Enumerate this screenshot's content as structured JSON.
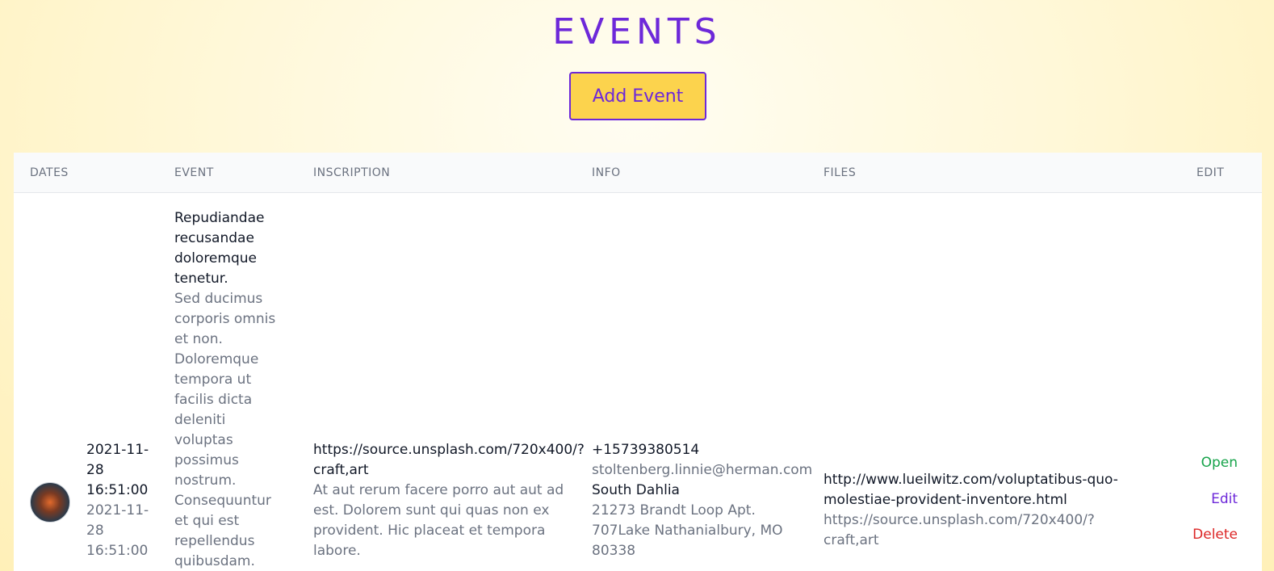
{
  "page": {
    "title": "EVENTS",
    "add_button": "Add Event"
  },
  "table": {
    "headers": {
      "dates": "DATES",
      "event": "EVENT",
      "inscription": "INSCRIPTION",
      "info": "INFO",
      "files": "FILES",
      "edit": "EDIT"
    },
    "rows": [
      {
        "avatar_icon": "event-thumbnail",
        "date_start": "2021-11-28 16:51:00",
        "date_end": "2021-11-28 16:51:00",
        "event_title": "Repudiandae recusandae doloremque tenetur.",
        "event_description": "Sed ducimus corporis omnis et non. Doloremque tempora ut facilis dicta deleniti voluptas possimus nostrum. Consequuntur et qui est repellendus quibusdam. Consectetur",
        "inscription_url": "https://source.unsplash.com/720x400/?craft,art",
        "inscription_text": "At aut rerum facere porro aut aut ad est. Dolorem sunt qui quas non ex provident. Hic placeat et tempora labore.",
        "phone": "+15739380514",
        "email": "stoltenberg.linnie@herman.com",
        "city": "South Dahlia",
        "address": "21273 Brandt Loop Apt. 707Lake Nathanialbury, MO 80338",
        "file_url": "http://www.lueilwitz.com/voluptatibus-quo-molestiae-provident-inventore.html",
        "file_image": "https://source.unsplash.com/720x400/?craft,art",
        "actions": {
          "open": "Open",
          "edit": "Edit",
          "delete": "Delete"
        }
      }
    ]
  },
  "colors": {
    "accent": "#6d28d9",
    "button_bg": "#fcd34d",
    "open": "#16a34a",
    "delete": "#dc2626"
  }
}
